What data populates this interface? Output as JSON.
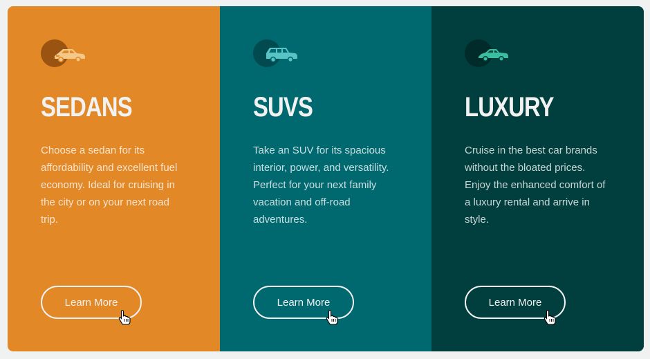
{
  "cards": [
    {
      "icon": "sedan-car-icon",
      "icon_color": "#f3c989",
      "title": "SEDANS",
      "description": "Choose a sedan for its affordability and excellent fuel economy. Ideal for cruising in the city or on your next road trip.",
      "button_label": "Learn More",
      "background": "#e38826"
    },
    {
      "icon": "suv-car-icon",
      "icon_color": "#59c4c6",
      "title": "SUVS",
      "description": "Take an SUV for its spacious interior, power, and versatility. Perfect for your next family vacation and off-road adventures.",
      "button_label": "Learn More",
      "background": "#006970"
    },
    {
      "icon": "luxury-car-icon",
      "icon_color": "#3bbda0",
      "title": "LUXURY",
      "description": "Cruise in the best car brands without the bloated prices. Enjoy the enhanced comfort of a luxury rental and arrive in style.",
      "button_label": "Learn More",
      "background": "#003f3d"
    }
  ]
}
